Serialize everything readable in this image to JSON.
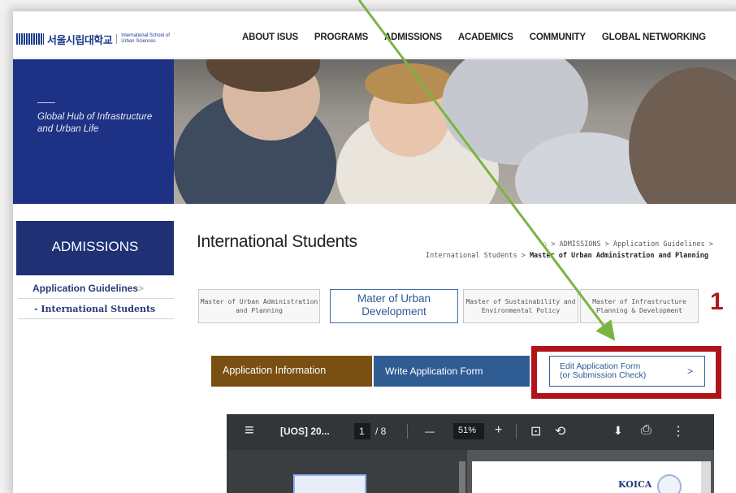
{
  "header": {
    "logo_kr": "서울시립대학교",
    "logo_en": "International School of Urban Sciences",
    "nav": [
      "ABOUT ISUS",
      "PROGRAMS",
      "ADMISSIONS",
      "ACADEMICS",
      "COMMUNITY",
      "GLOBAL NETWORKING"
    ]
  },
  "hero": {
    "tagline": "Global Hub of Infrastructure and Urban Life"
  },
  "sidebar": {
    "title": "ADMISSIONS",
    "items": [
      {
        "label": "Application Guidelines",
        "chevron": ">"
      },
      {
        "label": "- International Students"
      }
    ]
  },
  "main": {
    "title": "International Students",
    "breadcrumb_line1": "> ADMISSIONS > Application Guidelines >",
    "breadcrumb_line2_prefix": "International Students > ",
    "breadcrumb_line2_bold": "Master of Urban Administration and Planning",
    "program_tabs": [
      {
        "label": "Master of Urban Administration and Planning"
      },
      {
        "label": "Mater of Urban Development"
      },
      {
        "label": "Master of Sustainability and Environmental Policy"
      },
      {
        "label": "Master of Infrastructure Planning & Development"
      }
    ],
    "annotation_number": "1",
    "steps": {
      "info": "Application Information",
      "write": "Write Application Form",
      "edit_line1": "Edit Application Form",
      "edit_line2": "(or Submission Check)",
      "edit_chevron": ">"
    }
  },
  "viewer": {
    "menu_glyph": "≡",
    "file_title": "[UOS] 20...",
    "page_current": "1",
    "page_total": "/ 8",
    "zoom_out": "—",
    "zoom_level": "51%",
    "zoom_in": "+",
    "fit_glyph": "⊡",
    "rotate_glyph": "⟲",
    "download_glyph": "⬇",
    "print_glyph": "⎙",
    "more_glyph": "⋮",
    "doc_logo_text": "KOICA"
  },
  "colors": {
    "brand_navy": "#1e3285",
    "info_brown": "#7a4f12",
    "write_blue": "#305c94",
    "annotation_red": "#b0141a",
    "arrow_green": "#7cb342"
  }
}
